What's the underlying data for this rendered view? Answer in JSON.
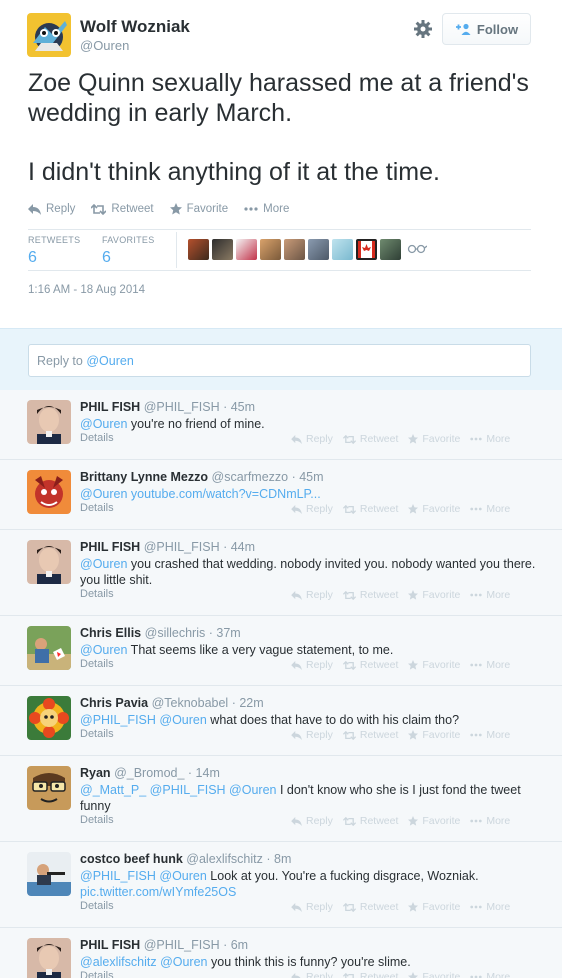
{
  "tweet": {
    "author_name": "Wolf Wozniak",
    "author_handle": "@Ouren",
    "follow_label": "Follow",
    "text_line1": "Zoe Quinn sexually harassed me at a friend's wedding in early March.",
    "text_line2": "I didn't think anything of it at the time.",
    "actions": {
      "reply": "Reply",
      "retweet": "Retweet",
      "favorite": "Favorite",
      "more": "More"
    },
    "stats": {
      "retweets_label": "RETWEETS",
      "retweets": "6",
      "favorites_label": "FAVORITES",
      "favorites": "6"
    },
    "timestamp": "1:16 AM - 18 Aug 2014"
  },
  "reply_box": {
    "prefix": "Reply to ",
    "mention": "@Ouren"
  },
  "reply_actions": {
    "reply": "Reply",
    "retweet": "Retweet",
    "favorite": "Favorite",
    "more": "More",
    "details": "Details"
  },
  "replies": [
    {
      "name": "PHIL FISH",
      "handle": "@PHIL_FISH",
      "time": "· 45m",
      "mentions": "@Ouren",
      "text": " you're no friend of mine."
    },
    {
      "name": "Brittany Lynne Mezzo",
      "handle": "@scarfmezzo",
      "time": "· 45m",
      "mentions": "@Ouren",
      "link": " youtube.com/watch?v=CDNmLP..."
    },
    {
      "name": "PHIL FISH",
      "handle": "@PHIL_FISH",
      "time": "· 44m",
      "mentions": "@Ouren",
      "text": " you crashed that wedding. nobody invited you. nobody wanted you there. you little shit."
    },
    {
      "name": "Chris Ellis",
      "handle": "@sillechris",
      "time": "· 37m",
      "mentions": "@Ouren",
      "text": " That seems like a very vague statement, to me."
    },
    {
      "name": "Chris Pavia",
      "handle": "@Teknobabel",
      "time": "· 22m",
      "mentions": "@PHIL_FISH @Ouren",
      "text": " what does that have to do with his claim tho?"
    },
    {
      "name": "Ryan",
      "handle": "@_Bromod_",
      "time": "· 14m",
      "mentions": "@_Matt_P_ @PHIL_FISH @Ouren",
      "text": " I don't know who she is I just fond the tweet funny"
    },
    {
      "name": "costco beef hunk",
      "handle": "@alexlifschitz",
      "time": "· 8m",
      "mentions": "@PHIL_FISH @Ouren",
      "text": " Look at you. You're a fucking disgrace, Wozniak.",
      "link": "pic.twitter.com/wIYmfe25OS"
    },
    {
      "name": "PHIL FISH",
      "handle": "@PHIL_FISH",
      "time": "· 6m",
      "mentions": "@alexlifschitz @Ouren",
      "text": " you think this is funny? you're slime."
    }
  ],
  "colors": {
    "link": "#55acee",
    "muted": "#8899a6",
    "text": "#292f33",
    "reply_bg": "#f5f8fa"
  }
}
